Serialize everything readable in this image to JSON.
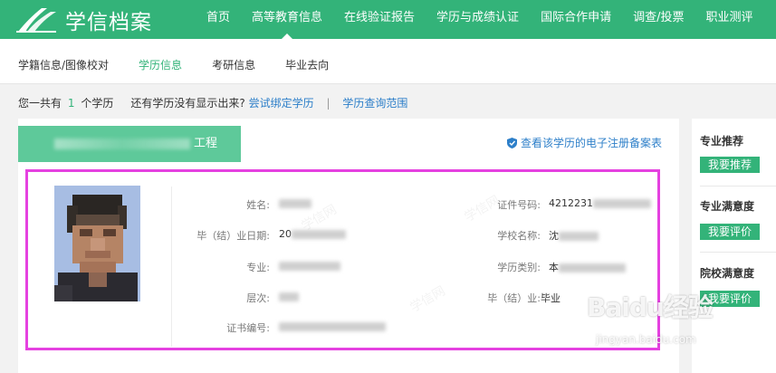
{
  "header": {
    "brand": "学信档案",
    "nav": [
      {
        "label": "首页",
        "active": false
      },
      {
        "label": "高等教育信息",
        "active": true
      },
      {
        "label": "在线验证报告",
        "active": false
      },
      {
        "label": "学历与成绩认证",
        "active": false
      },
      {
        "label": "国际合作申请",
        "active": false
      },
      {
        "label": "调查/投票",
        "active": false
      },
      {
        "label": "职业测评",
        "active": false
      }
    ]
  },
  "subnav": [
    {
      "label": "学籍信息/图像校对",
      "active": false
    },
    {
      "label": "学历信息",
      "active": true
    },
    {
      "label": "考研信息",
      "active": false
    },
    {
      "label": "毕业去向",
      "active": false
    }
  ],
  "info": {
    "prefix": "您一共有",
    "count": "1",
    "suffix": "个学历",
    "question": "还有学历没有显示出来?",
    "bind_link": "尝试绑定学历",
    "separator": "|",
    "range_link": "学历查询范围"
  },
  "record": {
    "tab_suffix": "工程",
    "registration_link": "查看该学历的电子注册备案表",
    "fields": {
      "name_label": "姓名:",
      "date_label": "毕（结）业日期:",
      "date_value": "20",
      "major_label": "专业:",
      "level_label": "层次:",
      "cert_label": "证书编号:",
      "id_label": "证件号码:",
      "id_value": "4212231",
      "school_label": "学校名称:",
      "school_value": "沈",
      "type_label": "学历类别:",
      "type_value": "本",
      "grad_label": "毕（结）业:",
      "grad_value": "毕业"
    }
  },
  "sidebar": [
    {
      "title": "专业推荐",
      "button": "我要推荐"
    },
    {
      "title": "专业满意度",
      "button": "我要评价"
    },
    {
      "title": "院校满意度",
      "button": "我要评价"
    }
  ],
  "watermark": {
    "text": "学信网",
    "brand": "Baidu经验",
    "url": "jingyan.baidu.com"
  },
  "colors": {
    "primary": "#33b379",
    "link": "#2d7fc9",
    "highlight_border": "#e541e0"
  }
}
